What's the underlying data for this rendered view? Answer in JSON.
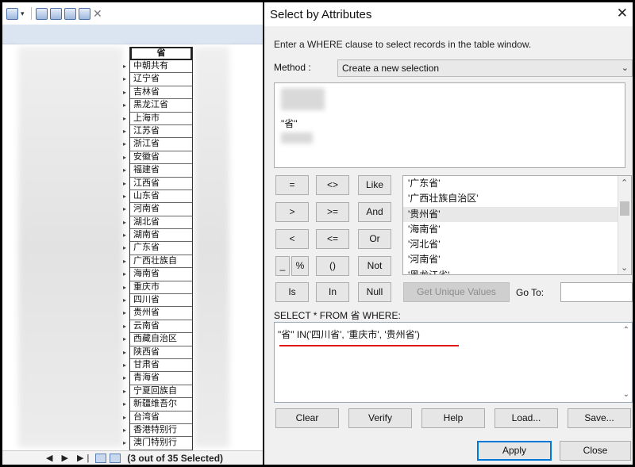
{
  "table_window": {
    "header": "省",
    "rows": [
      "中朝共有",
      "辽宁省",
      "吉林省",
      "黑龙江省",
      "上海市",
      "江苏省",
      "浙江省",
      "安徽省",
      "福建省",
      "江西省",
      "山东省",
      "河南省",
      "湖北省",
      "湖南省",
      "广东省",
      "广西壮族自",
      "海南省",
      "重庆市",
      "四川省",
      "贵州省",
      "云南省",
      "西藏自治区",
      "陕西省",
      "甘肃省",
      "青海省",
      "宁夏回族自",
      "新疆维吾尔",
      "台湾省",
      "香港特别行",
      "澳门特别行"
    ],
    "status": "(3 out of 35 Selected)",
    "nav": "◀ ▶ ▶|"
  },
  "dialog": {
    "title": "Select by Attributes",
    "close": "✕",
    "instruction": "Enter a WHERE clause to select records in the table window.",
    "method_label": "Method :",
    "method_value": "Create a new selection",
    "field_visible": "\"省\"",
    "operators": {
      "eq": "=",
      "ne": "<>",
      "like": "Like",
      "gt": ">",
      "ge": ">=",
      "and": "And",
      "lt": "<",
      "le": "<=",
      "or": "Or",
      "underscore": "_",
      "percent": "%",
      "paren": "()",
      "not": "Not",
      "is": "Is",
      "in": "In",
      "null": "Null"
    },
    "unique_values": [
      "'广东省'",
      "'广西壮族自治区'",
      "'贵州省'",
      "'海南省'",
      "'河北省'",
      "'河南省'",
      "'黑龙江省'"
    ],
    "selected_value_index": 2,
    "get_unique_label": "Get Unique Values",
    "goto_label": "Go To:",
    "sql_label": "SELECT * FROM 省 WHERE:",
    "sql_expression": "\"省\" IN('四川省', '重庆市', '贵州省')",
    "buttons": {
      "clear": "Clear",
      "verify": "Verify",
      "help": "Help",
      "load": "Load...",
      "save": "Save...",
      "apply": "Apply",
      "close": "Close"
    }
  },
  "colors": {
    "underline": "#e01818",
    "band": "#dbe5f1",
    "accent": "#0078d7"
  }
}
